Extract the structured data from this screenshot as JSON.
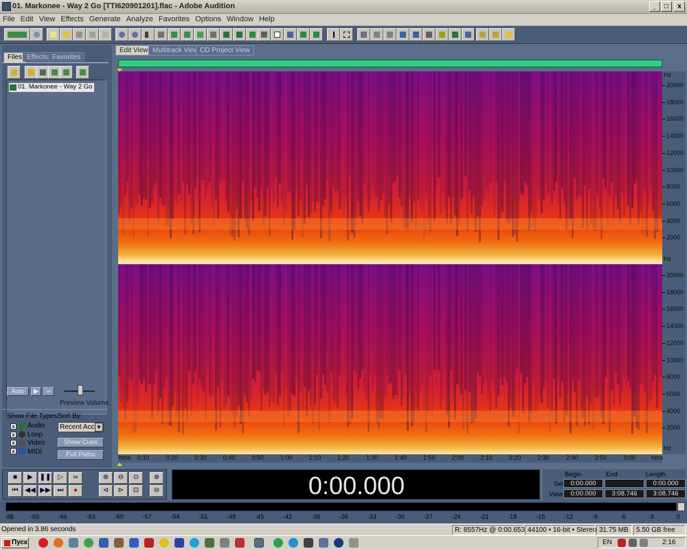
{
  "window": {
    "title": "01. Markonee - Way 2 Go [TTI620901201].flac - Adobe Audition",
    "min_label": "_",
    "max_label": "□",
    "close_label": "x"
  },
  "menu": [
    "File",
    "Edit",
    "View",
    "Effects",
    "Generate",
    "Analyze",
    "Favorites",
    "Options",
    "Window",
    "Help"
  ],
  "left_panel": {
    "tabs": [
      "Files",
      "Effects",
      "Favorites"
    ],
    "file_item": "01. Markonee - Way 2 Go ...",
    "auto_label": "Auto",
    "preview_volume_label": "Preview Volume",
    "show_file_types_label": "Show File Types:",
    "file_types": [
      "Audio",
      "Loop",
      "Video",
      "MIDI"
    ],
    "sort_by_label": "Sort By:",
    "sort_value": "Recent Acce",
    "show_cues_label": "Show Cues",
    "full_paths_label": "Full Paths"
  },
  "view_tabs": [
    "Edit View",
    "Multitrack View",
    "CD Project View"
  ],
  "spectrogram": {
    "hz_unit": "Hz",
    "hz_labels": [
      "20000",
      "18000",
      "16000",
      "14000",
      "12000",
      "10000",
      "8000",
      "6000",
      "4000",
      "2000"
    ],
    "time_labels": [
      "hms",
      "0:10",
      "0:20",
      "0:30",
      "0:40",
      "0:50",
      "1:00",
      "1:10",
      "1:20",
      "1:30",
      "1:40",
      "1:50",
      "2:00",
      "2:10",
      "2:20",
      "2:30",
      "2:40",
      "2:50",
      "3:00",
      "hms"
    ]
  },
  "transport": {
    "time": "0:00.000"
  },
  "selection": {
    "headers": [
      "Begin",
      "End",
      "Length"
    ],
    "sel_label": "Sel",
    "view_label": "View",
    "sel_values": [
      "0:00.000",
      "",
      "0:00.000"
    ],
    "view_values": [
      "0:00.000",
      "3:08.746",
      "3:08.746"
    ]
  },
  "meter": {
    "labels": [
      "dB",
      "-69",
      "-66",
      "-63",
      "-60",
      "-57",
      "-54",
      "-51",
      "-48",
      "-45",
      "-42",
      "-39",
      "-36",
      "-33",
      "-30",
      "-27",
      "-24",
      "-21",
      "-18",
      "-15",
      "-12",
      "-9",
      "-6",
      "-3",
      "0"
    ]
  },
  "status": {
    "message": "Opened in 3.86 seconds",
    "cursor": "R: 8557Hz @   0:00.653",
    "format": "44100 • 16-bit • Stereo",
    "size": "31.75 MB",
    "free": "5.50 GB free"
  },
  "taskbar": {
    "start_label": "Пуск",
    "lang": "EN",
    "clock": "2:16"
  }
}
